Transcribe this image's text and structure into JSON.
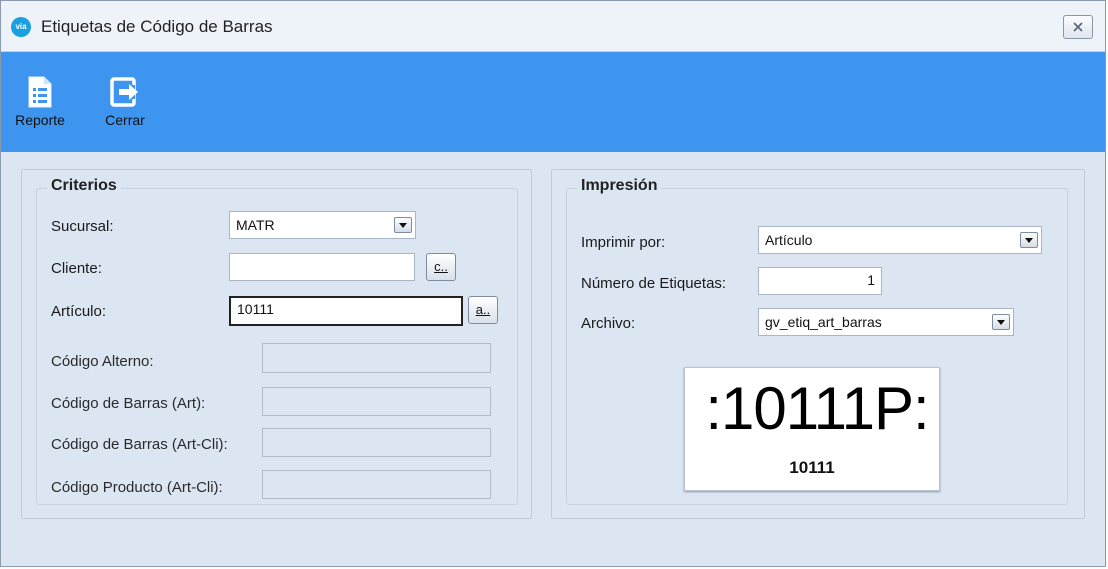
{
  "window": {
    "app_icon_text": "via",
    "title": "Etiquetas de Código de Barras"
  },
  "toolbar": {
    "report_label": "Reporte",
    "close_label": "Cerrar"
  },
  "criterios": {
    "title": "Criterios",
    "sucursal_label": "Sucursal:",
    "sucursal_value": "MATR",
    "cliente_label": "Cliente:",
    "cliente_value": "",
    "cliente_button": "c..",
    "articulo_label": "Artículo:",
    "articulo_value": "10111",
    "articulo_button": "a..",
    "codigo_alterno_label": "Código Alterno:",
    "codigo_barras_art_label": "Código de Barras (Art):",
    "codigo_barras_art_cli_label": "Código de Barras (Art-Cli):",
    "codigo_producto_label": "Código Producto (Art-Cli):"
  },
  "impresion": {
    "title": "Impresión",
    "imprimir_por_label": "Imprimir por:",
    "imprimir_por_value": "Artículo",
    "numero_etiquetas_label": "Número de Etiquetas:",
    "numero_etiquetas_value": "1",
    "archivo_label": "Archivo:",
    "archivo_value": "gv_etiq_art_barras",
    "preview_big_text": ":10111P:",
    "preview_small_text": "10111"
  },
  "colors": {
    "toolbar": "#3d95f0",
    "background": "#dce6f2"
  }
}
